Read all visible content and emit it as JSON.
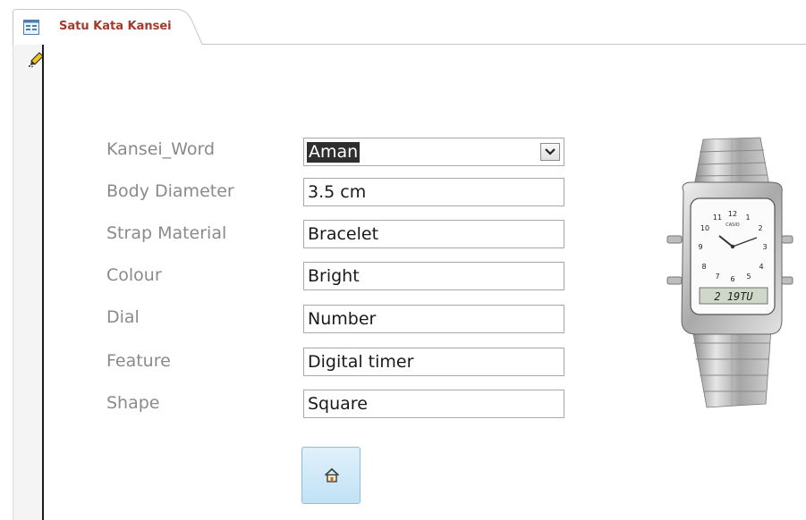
{
  "tab": {
    "title": "Satu Kata Kansei"
  },
  "icons": {
    "form_tab": "form-icon",
    "record_selector": "pencil-edit-icon",
    "home": "home-icon",
    "dropdown": "chevron-down-icon"
  },
  "form": {
    "fields": [
      {
        "label": "Kansei_Word",
        "value": "Aman"
      },
      {
        "label": "Body Diameter",
        "value": "3.5 cm"
      },
      {
        "label": "Strap Material",
        "value": "Bracelet"
      },
      {
        "label": "Colour",
        "value": "Bright"
      },
      {
        "label": "Dial",
        "value": "Number"
      },
      {
        "label": "Feature",
        "value": "Digital timer"
      },
      {
        "label": "Shape",
        "value": "Square"
      }
    ]
  },
  "watch": {
    "brand": "CASIO",
    "display": "2 19TU",
    "dial_numbers": [
      "12",
      "1",
      "2",
      "3",
      "4",
      "5",
      "6",
      "7",
      "8",
      "9",
      "10",
      "11"
    ]
  },
  "colors": {
    "tab_title": "#a33a2a",
    "label": "#8a8a8a",
    "button_fill": "#c2e2f6"
  }
}
